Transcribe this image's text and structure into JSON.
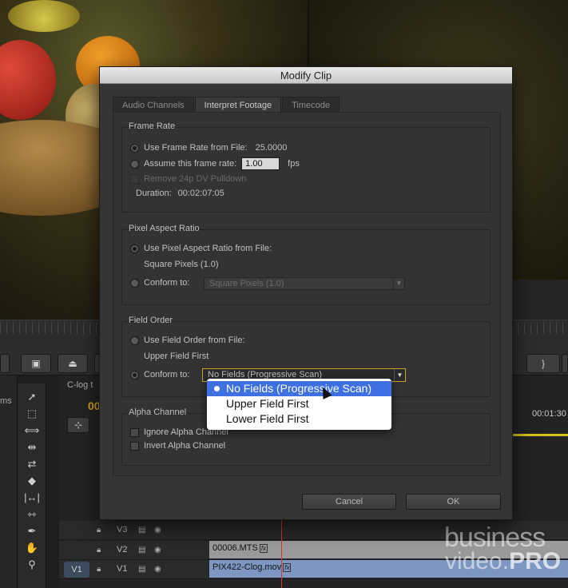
{
  "app": {
    "sequence_tab": "C-log t",
    "left_panel_label": "ms",
    "timecode_left": "00",
    "timecode_right": "00:01:30",
    "tracks": [
      {
        "name": "V3",
        "source": ""
      },
      {
        "name": "V2",
        "source": ""
      },
      {
        "name": "V1",
        "source": "V1"
      }
    ],
    "clips": {
      "v2": "00006.MTS",
      "v1": "PIX422-Clog.mov",
      "fx_badge": "fx"
    },
    "watermark_top": "business",
    "watermark_bottom_a": "video.",
    "watermark_bottom_b": "PRO",
    "accent_color": "#d6a21e",
    "playhead_color": "#d43a2a"
  },
  "dialog": {
    "title": "Modify Clip",
    "tabs": [
      {
        "label": "Audio Channels",
        "active": false
      },
      {
        "label": "Interpret Footage",
        "active": true
      },
      {
        "label": "Timecode",
        "active": false
      }
    ],
    "frame_rate": {
      "title": "Frame Rate",
      "use_file_label": "Use Frame Rate from File:",
      "file_value": "25.0000",
      "assume_label": "Assume this frame rate:",
      "assume_value": "1.00",
      "fps_label": "fps",
      "pulldown_label": "Remove 24p DV Pulldown",
      "duration_label": "Duration:",
      "duration_value": "00:02:07:05"
    },
    "pixel_aspect": {
      "title": "Pixel Aspect Ratio",
      "use_file_label": "Use Pixel Aspect Ratio from File:",
      "file_value": "Square Pixels (1.0)",
      "conform_label": "Conform to:",
      "conform_value": "Square Pixels (1.0)"
    },
    "field_order": {
      "title": "Field Order",
      "use_file_label": "Use Field Order from File:",
      "file_value": "Upper Field First",
      "conform_label": "Conform to:",
      "conform_value": "No Fields (Progressive Scan)"
    },
    "alpha": {
      "title": "Alpha Channel",
      "ignore_label": "Ignore Alpha Channel",
      "invert_label": "Invert Alpha Channel"
    },
    "cancel_label": "Cancel",
    "ok_label": "OK"
  },
  "dropdown": {
    "options": [
      "No Fields (Progressive Scan)",
      "Upper Field First",
      "Lower Field First"
    ],
    "selected_index": 0,
    "highlight_color": "#3f6fe0"
  }
}
